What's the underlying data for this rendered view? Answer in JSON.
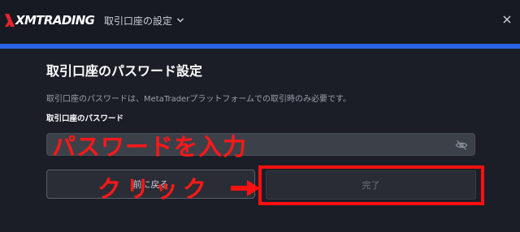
{
  "header": {
    "logo_text": "XMTRADING",
    "account_menu_label": "取引口座の設定",
    "icons": {
      "menu": "chevron-down-icon",
      "close": "close-icon"
    }
  },
  "colors": {
    "accent": "#2b63e6",
    "background": "#1b1e27",
    "annotation": "#ff1010"
  },
  "form": {
    "title": "取引口座のパスワード設定",
    "description": "取引口座のパスワードは、MetaTraderプラットフォームでの取引時のみ必要です。",
    "password_label": "取引口座のパスワード",
    "password_value": "",
    "password_toggle_icon": "eye-slash-icon",
    "back_button": "前に戻る",
    "done_button": "完了"
  },
  "annotations": {
    "enter_password": "パスワードを入力",
    "click": "クリック"
  }
}
